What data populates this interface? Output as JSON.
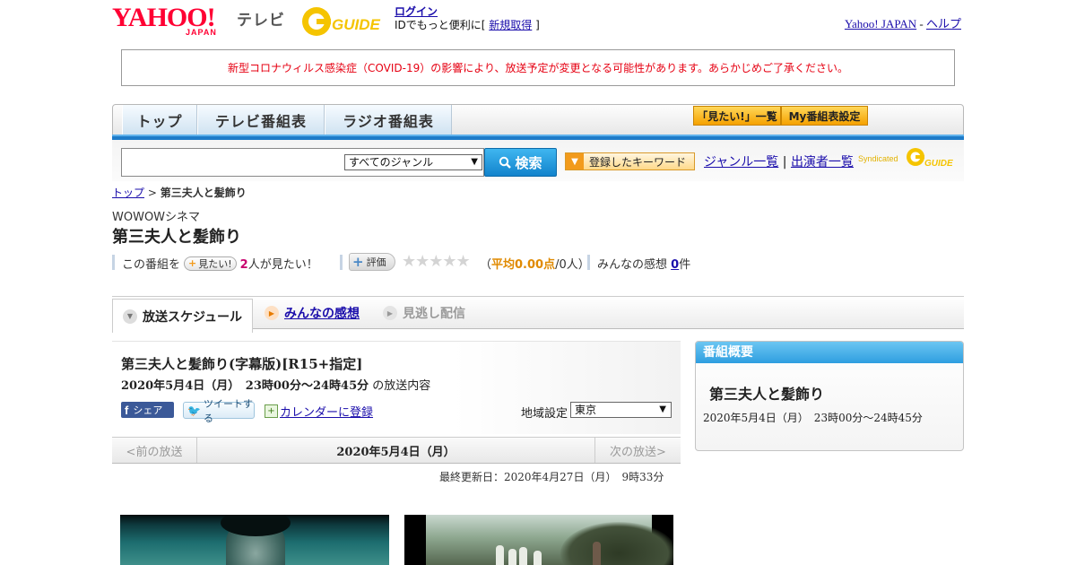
{
  "header": {
    "yahoo_logo": "YAHOO!",
    "yahoo_japan": "JAPAN",
    "tv_label": "テレビ",
    "gguide_logo": "G GUIDE",
    "login": "ログイン",
    "login_sub_prefix": "IDでもっと便利に[",
    "signup": "新規取得",
    "login_sub_suffix": "]",
    "yahoo_japan_link": "Yahoo! JAPAN",
    "sep": "-",
    "help_link": "ヘルプ"
  },
  "notice": "新型コロナウィルス感染症（COVID-19）の影響により、放送予定が変更となる可能性があります。あらかじめご了承ください。",
  "nav": {
    "top": "トップ",
    "tv": "テレビ番組表",
    "radio": "ラジオ番組表",
    "mitai_list": "「見たい!」一覧",
    "my_setting": "My番組表設定"
  },
  "search": {
    "genre_selected": "すべてのジャンル",
    "button": "検索",
    "keyword_button": "登録したキーワード",
    "genre_list": "ジャンル一覧",
    "divider": "|",
    "performer_list": "出演者一覧",
    "syndicated": "Syndicated",
    "syndicated_logo": "GUIDE"
  },
  "breadcrumb": {
    "top": "トップ",
    "sep": ">",
    "current": "第三夫人と髪飾り"
  },
  "program": {
    "channel": "WOWOWシネマ",
    "title": "第三夫人と髪飾り"
  },
  "meta": {
    "prefix": "この番組を",
    "mitai_badge": "見たい!",
    "mitai_count": "2",
    "mitai_suffix": "人が見たい！",
    "rate_label": "評価",
    "stars": "★★★★★",
    "avg_open": "（",
    "avg_value": "平均0.00点",
    "avg_rest": "/0人）",
    "kansou_label": "みんなの感想",
    "kansou_count": "0",
    "kansou_unit": "件"
  },
  "tabs": {
    "schedule": "放送スケジュール",
    "kansou": "みんなの感想",
    "minogashi": "見逃し配信"
  },
  "broadcast": {
    "title": "第三夫人と髪飾り(字幕版)[R15+指定]",
    "datetime": "2020年5月4日（月）　23時00分～24時45分",
    "suffix": "の放送内容",
    "share": "シェア",
    "tweet": "ツイートする",
    "calendar": "カレンダーに登録",
    "region_label": "地域設定",
    "region_value": "東京"
  },
  "date_nav": {
    "prev": "<前の放送",
    "current": "2020年5月4日（月）",
    "next": "次の放送>"
  },
  "updated": "最終更新日：2020年4月27日（月）　9時33分",
  "sidebar": {
    "heading": "番組概要",
    "title": "第三夫人と髪飾り",
    "time": "2020年5月4日（月）　23時00分～24時45分"
  },
  "colors": {
    "brand_red": "#ff0033",
    "notice_red": "#e60012",
    "accent_blue": "#1e7bc8",
    "button_orange": "#f5a100"
  }
}
